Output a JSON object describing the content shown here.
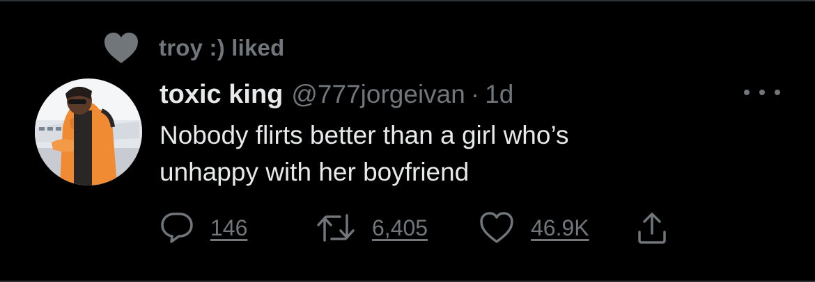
{
  "social_context": {
    "icon": "heart-icon",
    "text": "troy :) liked"
  },
  "tweet": {
    "avatar": "avatar",
    "display_name": "toxic king",
    "handle": "@777jorgeivan",
    "separator": "·",
    "time": "1d",
    "text": "Nobody flirts better than a girl who’s\nunhappy with her boyfriend",
    "more_icon": "more-horizontal-icon"
  },
  "actions": {
    "reply": {
      "icon": "reply-icon",
      "count": "146"
    },
    "retweet": {
      "icon": "retweet-icon",
      "count": "6,405"
    },
    "like": {
      "icon": "heart-outline-icon",
      "count": "46.9K"
    },
    "share": {
      "icon": "share-icon"
    }
  },
  "colors": {
    "background": "#000000",
    "primary_text": "#e7e9ea",
    "secondary_text": "#71767b",
    "divider": "#2f3336"
  }
}
